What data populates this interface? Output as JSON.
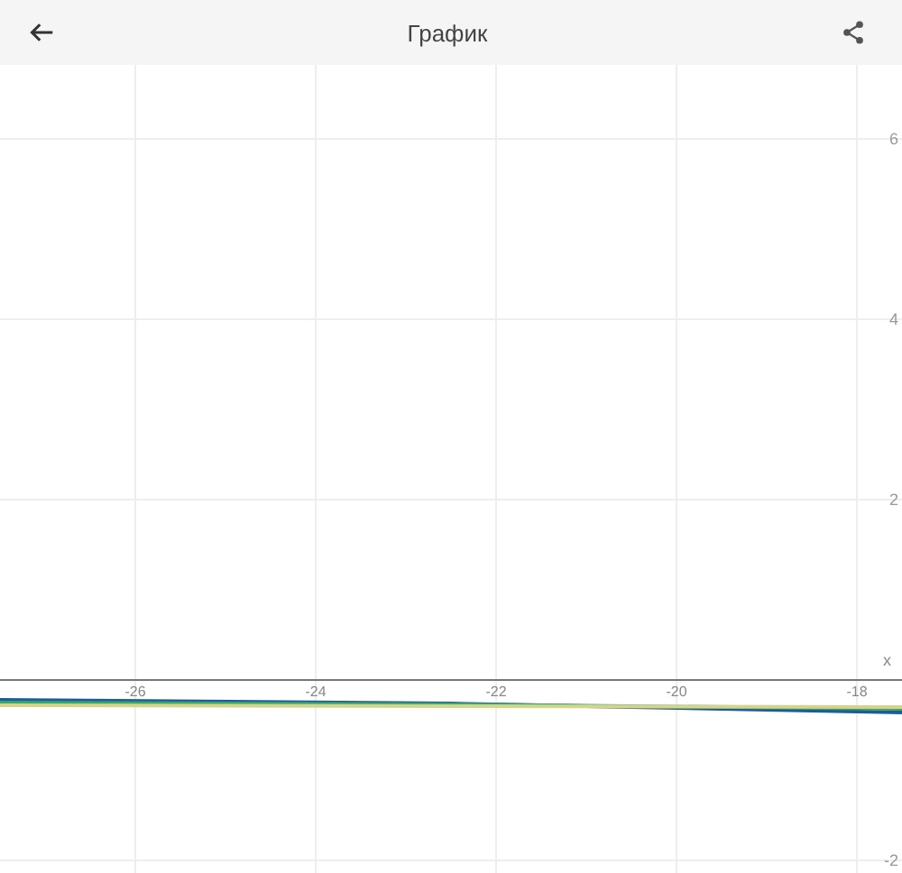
{
  "header": {
    "title": "График"
  },
  "chart_data": {
    "type": "line",
    "xlabel": "x",
    "x": [
      -27.5,
      -22.5,
      -17.5
    ],
    "series": [
      {
        "color": "#1e5aa0",
        "values": [
          -0.22,
          -0.26,
          -0.36
        ]
      },
      {
        "color": "#3aa66a",
        "values": [
          -0.25,
          -0.27,
          -0.32
        ]
      },
      {
        "color": "#d6d48a",
        "values": [
          -0.28,
          -0.29,
          -0.3
        ]
      }
    ],
    "xlim": [
      -27.5,
      -17.5
    ],
    "ylim": [
      -2.14,
      7.54
    ],
    "xticks": [
      -26,
      -24,
      -22,
      -20,
      -18
    ],
    "yticks": [
      6,
      4,
      2,
      -2
    ],
    "grid": true
  }
}
